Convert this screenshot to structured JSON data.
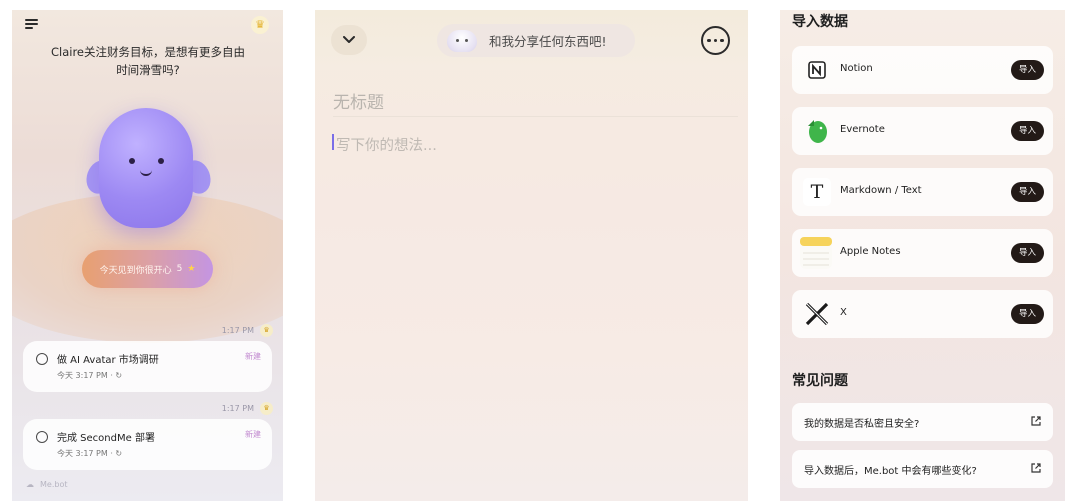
{
  "screen1": {
    "greeting": "Claire关注财务目标，是想有更多自由时间滑雪吗?",
    "today_pill": "今天见到你很开心",
    "today_count": "5",
    "tasks": [
      {
        "time": "1:17 PM",
        "title": "做 AI Avatar 市场调研",
        "meta": "今天 3:17 PM · ↻",
        "tag": "新建"
      },
      {
        "time": "1:17 PM",
        "title": "完成 SecondMe 部署",
        "meta": "今天 3:17 PM · ↻",
        "tag": "新建"
      }
    ],
    "footer_text": "Me.bot"
  },
  "screen2": {
    "prompt": "和我分享任何东西吧!",
    "title_placeholder": "无标题",
    "body_placeholder": "写下你的想法..."
  },
  "screen3": {
    "import_heading": "导入数据",
    "import_sources": [
      {
        "name": "Notion",
        "icon": "notion-icon",
        "button": "导入"
      },
      {
        "name": "Evernote",
        "icon": "evernote-icon",
        "button": "导入"
      },
      {
        "name": "Markdown / Text",
        "icon": "markdown-icon",
        "button": "导入"
      },
      {
        "name": "Apple Notes",
        "icon": "apple-notes-icon",
        "button": "导入"
      },
      {
        "name": "X",
        "icon": "x-icon",
        "button": "导入"
      }
    ],
    "faq_heading": "常见问题",
    "faqs": [
      {
        "question": "我的数据是否私密且安全?"
      },
      {
        "question": "导入数据后，Me.bot 中会有哪些变化?"
      }
    ]
  }
}
